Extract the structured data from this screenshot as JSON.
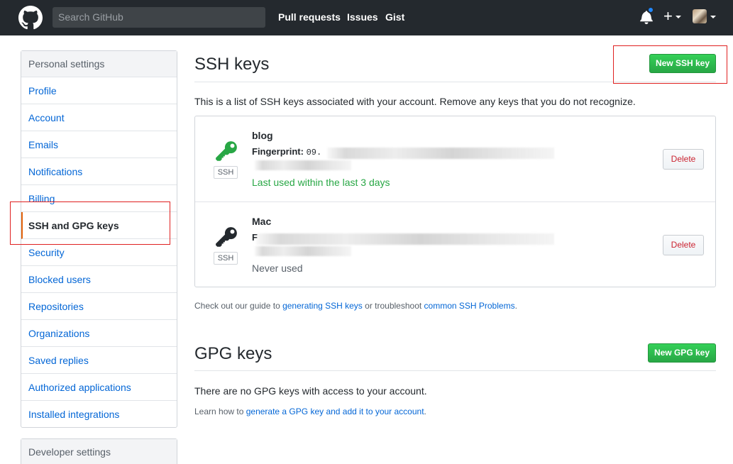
{
  "header": {
    "search_placeholder": "Search GitHub",
    "nav": [
      "Pull requests",
      "Issues",
      "Gist"
    ],
    "plus": "+",
    "notification_color": "#2188ff"
  },
  "sidebar": {
    "heading": "Personal settings",
    "items": [
      {
        "label": "Profile"
      },
      {
        "label": "Account"
      },
      {
        "label": "Emails"
      },
      {
        "label": "Notifications"
      },
      {
        "label": "Billing"
      },
      {
        "label": "SSH and GPG keys",
        "selected": true
      },
      {
        "label": "Security"
      },
      {
        "label": "Blocked users"
      },
      {
        "label": "Repositories"
      },
      {
        "label": "Organizations"
      },
      {
        "label": "Saved replies"
      },
      {
        "label": "Authorized applications"
      },
      {
        "label": "Installed integrations"
      }
    ],
    "developer_heading": "Developer settings"
  },
  "ssh": {
    "title": "SSH keys",
    "new_button": "New SSH key",
    "description": "This is a list of SSH keys associated with your account. Remove any keys that you do not recognize.",
    "keys": [
      {
        "title": "blog",
        "fingerprint_label": "Fingerprint:",
        "fingerprint_value": "09.",
        "tag": "SSH",
        "last_used": "Last used within the last 3 days",
        "icon_color": "#28a745",
        "delete": "Delete"
      },
      {
        "title": "Mac",
        "fingerprint_label": "F",
        "fingerprint_value": "",
        "tag": "SSH",
        "last_used": "Never used",
        "icon_color": "#24292e",
        "delete": "Delete"
      }
    ],
    "guide_prefix": "Check out our guide to ",
    "guide_link1": "generating SSH keys",
    "guide_middle": " or troubleshoot ",
    "guide_link2": "common SSH Problems",
    "guide_suffix": "."
  },
  "gpg": {
    "title": "GPG keys",
    "new_button": "New GPG key",
    "empty": "There are no GPG keys with access to your account.",
    "learn_prefix": "Learn how to ",
    "learn_link": "generate a GPG key and add it to your account",
    "learn_suffix": "."
  },
  "colors": {
    "header_bg": "#24292e",
    "link": "#0366d6",
    "green": "#28a745",
    "selected_border": "#e36209",
    "annotation": "#e02020"
  }
}
